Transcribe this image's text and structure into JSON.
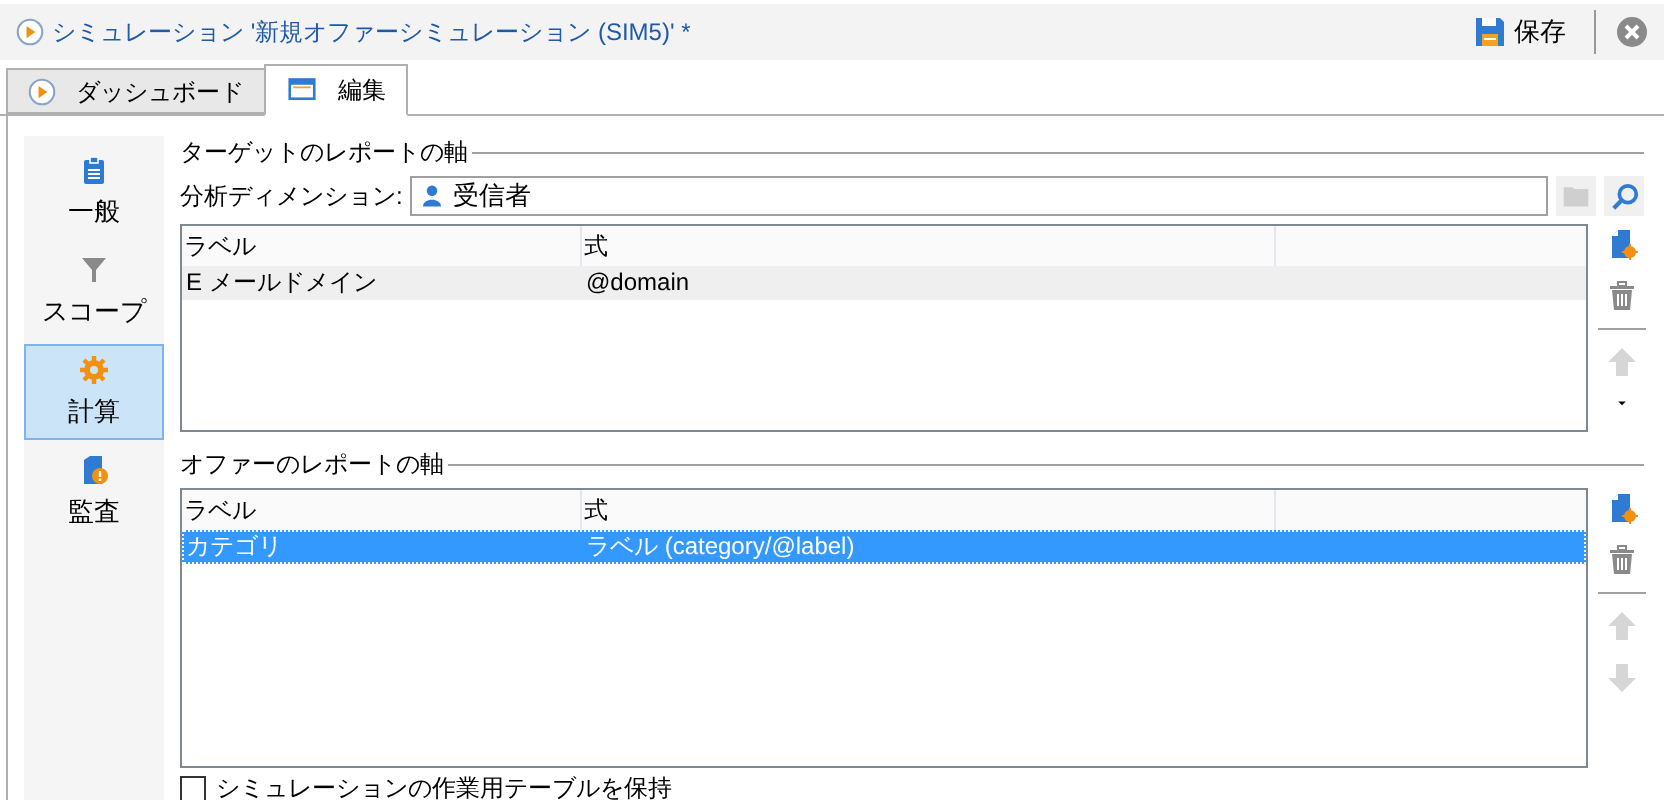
{
  "window": {
    "title": "シミュレーション '新規オファーシミュレーション (SIM5)' *",
    "save_label": "保存"
  },
  "tabs": [
    {
      "label": "ダッシュボード",
      "kind": "dashboard",
      "selected": false
    },
    {
      "label": "編集",
      "kind": "edit",
      "selected": true
    }
  ],
  "sidebar": {
    "items": [
      {
        "label": "一般",
        "kind": "general",
        "selected": false
      },
      {
        "label": "スコープ",
        "kind": "scope",
        "selected": false
      },
      {
        "label": "計算",
        "kind": "calc",
        "selected": true
      },
      {
        "label": "監査",
        "kind": "audit",
        "selected": false
      }
    ]
  },
  "target_axes": {
    "heading": "ターゲットのレポートの軸",
    "dimension_label": "分析ディメンション:",
    "dimension_value": "受信者",
    "columns": [
      "ラベル",
      "式"
    ],
    "rows": [
      {
        "label": "E メールドメイン",
        "expression": "@domain",
        "selected": false
      }
    ],
    "toolbar": [
      {
        "kind": "new",
        "disabled": false
      },
      {
        "kind": "delete",
        "disabled": false
      },
      {
        "kind": "up",
        "disabled": true
      },
      {
        "kind": "more",
        "disabled": false
      }
    ]
  },
  "offer_axes": {
    "heading": "オファーのレポートの軸",
    "columns": [
      "ラベル",
      "式"
    ],
    "rows": [
      {
        "label": "カテゴリ",
        "expression": "ラベル (category/@label)",
        "selected": true
      }
    ],
    "toolbar": [
      {
        "kind": "new",
        "disabled": false
      },
      {
        "kind": "delete",
        "disabled": false
      },
      {
        "kind": "up",
        "disabled": true
      },
      {
        "kind": "down",
        "disabled": true
      }
    ]
  },
  "keep_tables": {
    "label": "シミュレーションの作業用テーブルを保持",
    "checked": false
  }
}
